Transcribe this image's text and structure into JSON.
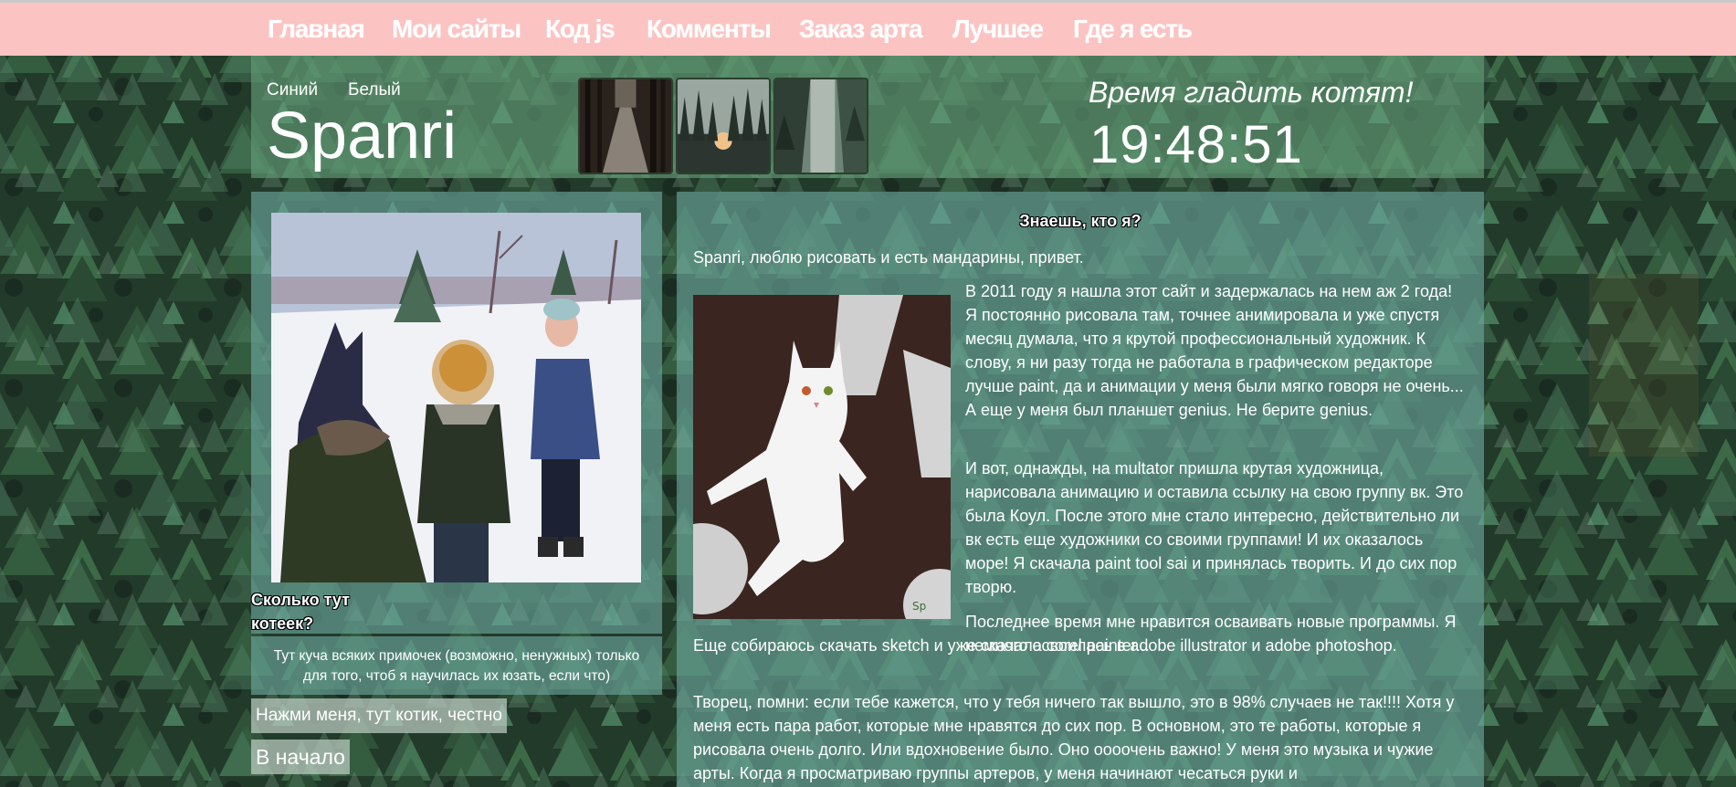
{
  "nav": {
    "items": [
      {
        "label": "Главная"
      },
      {
        "label": "Мои сайты"
      },
      {
        "label": "Код js"
      },
      {
        "label": "Комменты"
      },
      {
        "label": "Заказ арта"
      },
      {
        "label": "Лучшее"
      },
      {
        "label": "Где я есть"
      }
    ]
  },
  "header": {
    "themes": [
      "Синий",
      "Белый"
    ],
    "site_title": "Spanri",
    "slogan": "Время гладить котят!",
    "clock": "19:48:51"
  },
  "left": {
    "cat_count": "Сколько тут котеек?",
    "note": "Тут куча всяких примочек (возможно, ненужных) только для того, чтоб я научилась их юзать, если что)",
    "cat_button": "Нажми меня, тут котик, честно",
    "home_button": "В начало"
  },
  "content": {
    "title": "Знаешь, кто я?",
    "intro": "Spanri, люблю рисовать и есть мандарины, привет.",
    "p1": "В 2011 году я нашла этот сайт и задержалась на нем аж 2 года! Я постоянно рисовала там, точнее анимировала и уже спустя месяц думала, что я крутой профессиональный художник. К слову, я ни разу тогда не работала в графическом редакторе лучше paint, да и анимации у меня были мягко говоря не очень... А еще у меня был планшет genius. Не берите genius.",
    "p2": "И вот, однажды, на multator пришла крутая художница, нарисовала анимацию и оставила ссылку на свою группу вк. Это была Коул. После этого мне стало интересно, действительно ли вк есть еще художники со своими группами! И их оказалось море! Я скачала paint tool sai и принялась творить. И до сих пор творю.",
    "p3": "Последнее время мне нравится осваивать новые программы. Я немного освоилась в adobe illustrator и adobe photoshop.",
    "p3b": "Еще собираюсь скачать sketch и уже скачала corel painter...",
    "p4": "Творец, помни: если тебе кажется, что у тебя ничего так вышло, это в 98% случаев не так!!!! Хотя у меня есть пара работ, которые мне нравятся до сих пор. В основном, это те работы, которые я рисовала очень долго. Или вдохновение было. Оно оооочень важно! У меня это музыка и чужие арты. Когда я просматриваю группы артеров, у меня начинают чесаться руки и"
  },
  "colors": {
    "nav_bg": "#fbc4c3",
    "panel_bg": "#6eaaa0",
    "header_bg": "#65a07a"
  }
}
